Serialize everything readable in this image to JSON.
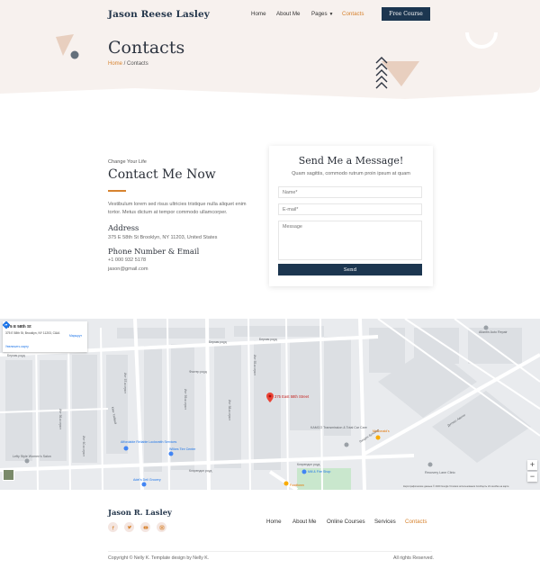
{
  "header": {
    "brand": "Jason Reese Lasley",
    "nav": [
      {
        "label": "Home"
      },
      {
        "label": "About Me"
      },
      {
        "label": "Pages"
      },
      {
        "label": "Contacts"
      }
    ],
    "cta_label": "Free Course",
    "active_color": "#d7832f",
    "brand_color": "#1c3650"
  },
  "hero": {
    "title": "Contacts",
    "breadcrumb_home": "Home",
    "breadcrumb_sep": " / ",
    "breadcrumb_current": "Contacts",
    "background": "#f7f1ee"
  },
  "contact": {
    "tagline": "Change Your Life",
    "heading": "Contact Me Now",
    "intro": "Vestibulum lorem sed risus ultricies tristique nulla aliquet enim tortor. Metus dictum at tempor commodo ullamcorper.",
    "address_heading": "Address",
    "address": "375 E 58th St Brooklyn, NY 11203, United States",
    "phone_heading": "Phone Number & Email",
    "phone": "+1 000 932 5178",
    "email": "jason@gmail.com"
  },
  "form": {
    "title": "Send Me a Message!",
    "subtitle": "Quam sagittis, commodo rutrum proin ipsum at quam",
    "name_placeholder": "Name*",
    "email_placeholder": "E-mail*",
    "message_placeholder": "Message",
    "send_label": "Send"
  },
  "map": {
    "panel_title": "375 E 58th St",
    "panel_address": "375 E 58th St, Brooklyn, NY 11203, США",
    "panel_link": "Увеличить карту",
    "route_label": "Маршрут",
    "marker_label": "375 East 58th Street",
    "zoom_in": "+",
    "zoom_out": "−",
    "attribution": "Картографические данные © 2020 Google   Условия использования   Сообщить об ошибке на карте",
    "street_labels": {
      "s1": "Бергам роуд",
      "s2": "Бергам роуд",
      "s3": "Бергам роуд",
      "s4": "Фостер роуд",
      "s5": "Ист 59-я стрит",
      "s6": "Ист 57-я стрит",
      "s7": "Кинг Хайвей",
      "s8": "Ист 56-я стрит",
      "s9": "Ист 55-я стрит",
      "s10": "Клэрендон роуд",
      "s11": "Клэрендон роуд",
      "s12": "Дитмас Авеню",
      "s13": "Линден бульвар",
      "s14": "Ист 60-я стрит",
      "s15": "Ист 58-я стрит"
    },
    "pois": {
      "p1": "Affordable Reliable Locksmith Services",
      "p2": "Wilkes Tire Center",
      "p3": "Lefty Style Women's Salon",
      "p4": "Adel's Deli Grocery",
      "p5": "KAMCO Transmission & Total Car Care",
      "p6": "McDonald's",
      "p7": "Mill & Fire Shop",
      "p8": "Foodtown",
      "p9": "Allantin Auto Repair",
      "p10": "Recovery Lane Clinic"
    }
  },
  "footer": {
    "brand": "Jason R. Lasley",
    "social_icons": [
      "facebook-icon",
      "twitter-icon",
      "youtube-icon",
      "instagram-icon"
    ],
    "nav": [
      {
        "label": "Home"
      },
      {
        "label": "About Me"
      },
      {
        "label": "Online Courses"
      },
      {
        "label": "Services"
      },
      {
        "label": "Contacts"
      }
    ],
    "copyright": "Copyright © Nelly K. Template design by Nelly K.",
    "rights": "All rights Reserved."
  }
}
